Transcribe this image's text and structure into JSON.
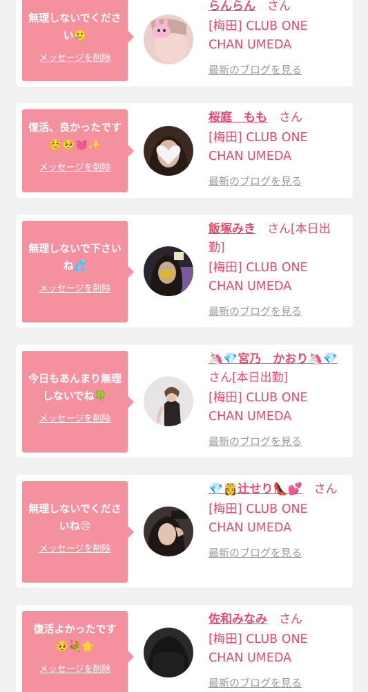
{
  "colors": {
    "page_bg": "#f1f1f1",
    "bubble_bg": "#f5919f",
    "name_color": "#e84a6b",
    "link_gray": "#9a9a9a"
  },
  "delete_label": "メッセージを削除",
  "blog_label": "最新のブログを見る",
  "san_suffix": "さん",
  "messages": [
    {
      "message": "無理しないでください🥲",
      "cast_name": "らんらん",
      "suffix": "さん",
      "shop": "[梅田] CLUB ONE CHAN UMEDA",
      "avatar_icon": "cast-photo-pink-bunny-icon"
    },
    {
      "message": "復活、良かったです☺️🥺💓✨",
      "cast_name": "桜庭　もも",
      "suffix": "さん",
      "shop": "[梅田] CLUB ONE CHAN UMEDA",
      "avatar_icon": "cast-photo-heart-icon"
    },
    {
      "message": "無理しないで下さいね💦",
      "cast_name": "飯塚みき",
      "suffix": "さん[本日出勤]",
      "shop": "[梅田] CLUB ONE CHAN UMEDA",
      "avatar_icon": "cast-photo-icon"
    },
    {
      "message": "今日もあんまり無理しないでね🍀",
      "cast_name": "🦄💎宮乃　かおり🦄💎",
      "suffix": "さん[本日出勤]",
      "shop": "[梅田] CLUB ONE CHAN UMEDA",
      "avatar_icon": "cast-photo-icon"
    },
    {
      "message": "無理しないでくださいね😢",
      "cast_name": "💎👸辻せり👠💕",
      "suffix": "さん",
      "shop": "[梅田] CLUB ONE CHAN UMEDA",
      "avatar_icon": "cast-photo-icon"
    },
    {
      "message": "復活よかったです🥺💐🌟",
      "cast_name": "佐和みなみ",
      "suffix": "さん",
      "shop": "[梅田] CLUB ONE CHAN UMEDA",
      "avatar_icon": "cast-photo-icon"
    }
  ]
}
